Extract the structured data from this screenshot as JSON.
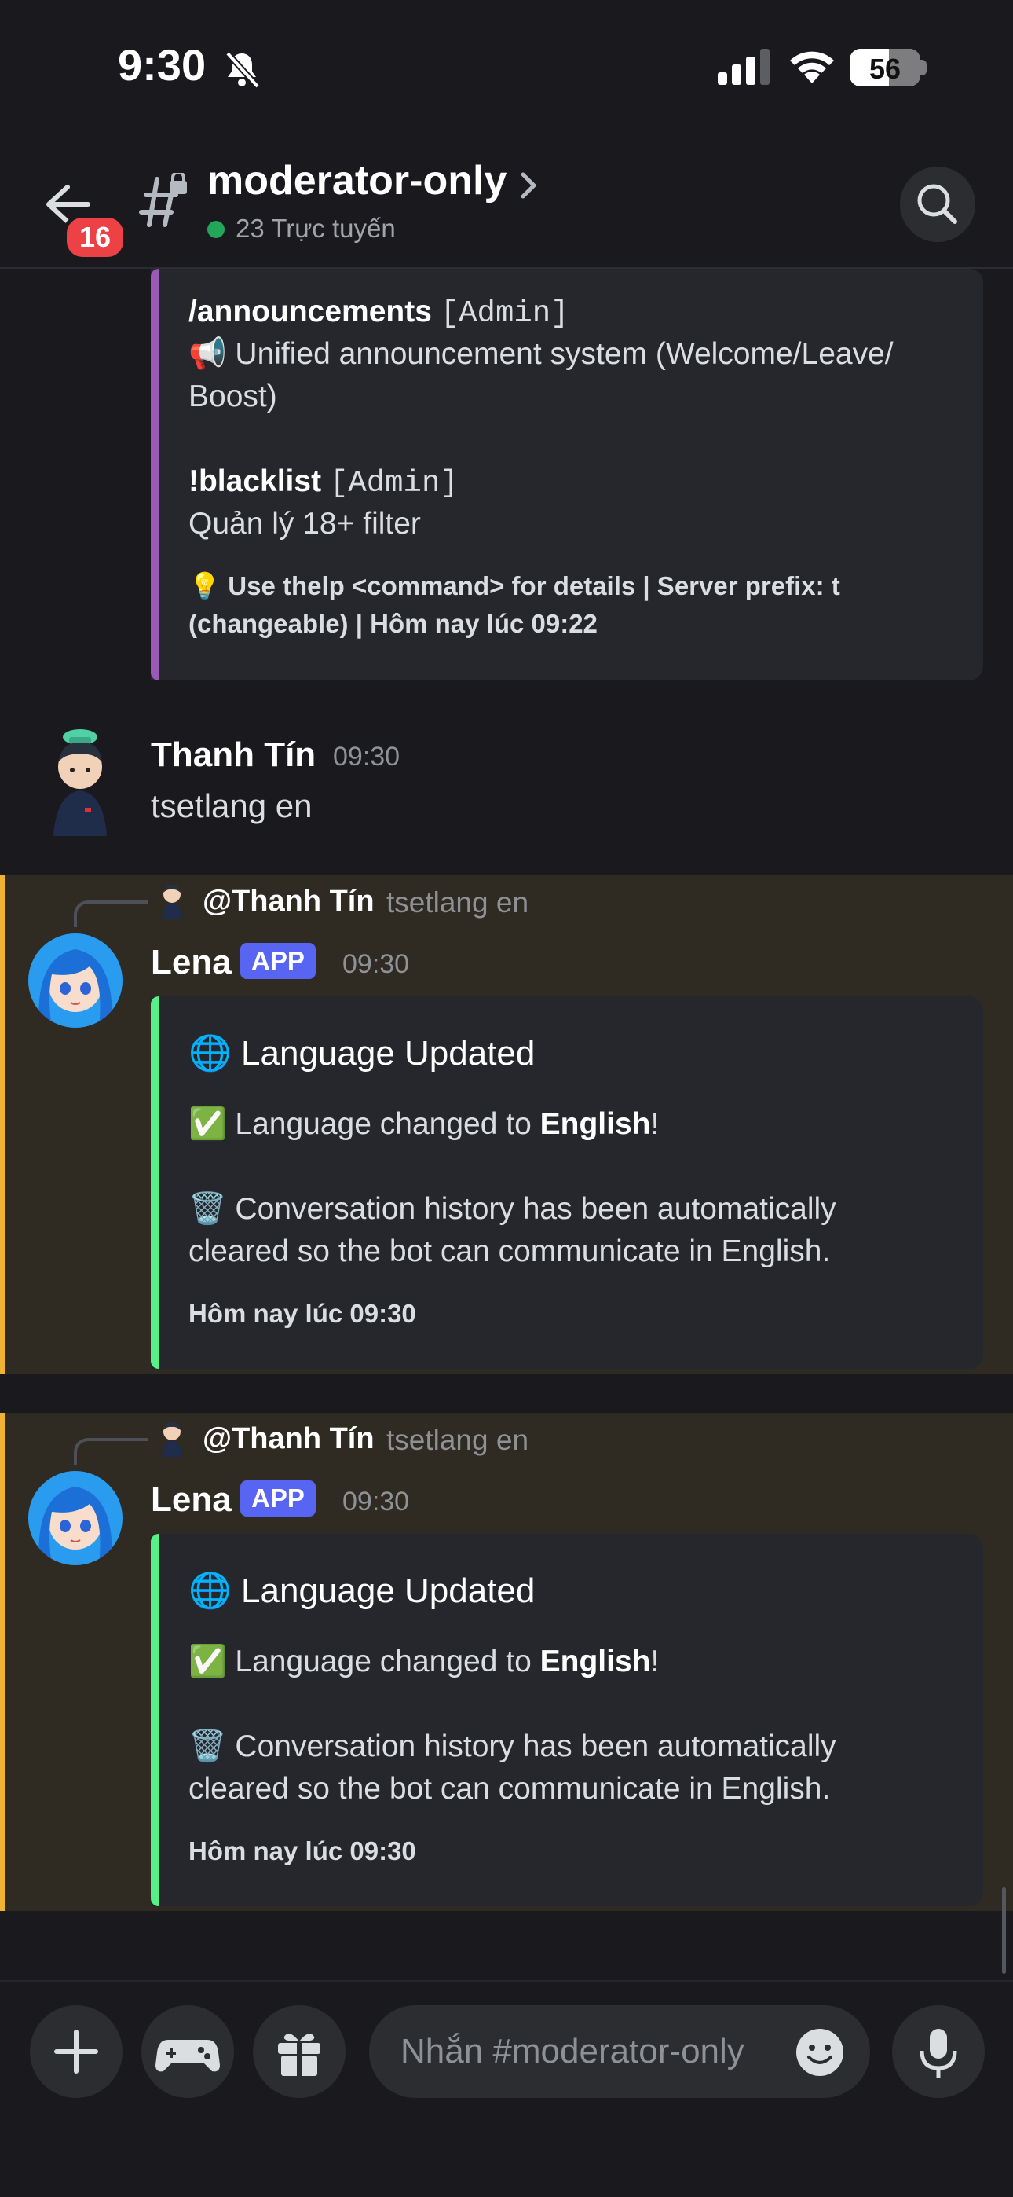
{
  "status_bar": {
    "time": "9:30",
    "battery": "56",
    "battery_level": 0.56
  },
  "header": {
    "back_badge": "16",
    "channel_name": "moderator-only",
    "online_text": "23 Trực tuyến"
  },
  "prev_embed": {
    "cmd1_name": "/announcements",
    "cmd1_tag": "[Admin]",
    "cmd1_icon": "📢",
    "cmd1_desc": "Unified announcement system (Welcome/Leave/",
    "cmd1_desc2": "Boost)",
    "cmd2_name": "!blacklist",
    "cmd2_tag": "[Admin]",
    "cmd2_desc": "Quản lý 18+ filter",
    "footer_icon": "💡",
    "footer_line1": "Use thelp <command> for details | Server prefix: t",
    "footer_line2": "(changeable) | Hôm nay lúc 09:22",
    "accent": "#9b59b6"
  },
  "user_message": {
    "author": "Thanh Tín",
    "time": "09:30",
    "text": "tsetlang en"
  },
  "bot_messages": [
    {
      "reply_to": "@Thanh Tín",
      "reply_text": "tsetlang en",
      "author": "Lena",
      "tag": "APP",
      "time": "09:30",
      "embed_icon": "🌐",
      "embed_title": "Language Updated",
      "line1_icon": "✅",
      "line1_prefix": "Language changed to ",
      "line1_bold": "English",
      "line1_suffix": "!",
      "line2_icon": "🗑️",
      "line2_a": "Conversation history has been automatically",
      "line2_b": "cleared so the bot can communicate in English.",
      "footer": "Hôm nay lúc 09:30",
      "accent": "#57f287"
    },
    {
      "reply_to": "@Thanh Tín",
      "reply_text": "tsetlang en",
      "author": "Lena",
      "tag": "APP",
      "time": "09:30",
      "embed_icon": "🌐",
      "embed_title": "Language Updated",
      "line1_icon": "✅",
      "line1_prefix": "Language changed to ",
      "line1_bold": "English",
      "line1_suffix": "!",
      "line2_icon": "🗑️",
      "line2_a": "Conversation history has been automatically",
      "line2_b": "cleared so the bot can communicate in English.",
      "footer": "Hôm nay lúc 09:30",
      "accent": "#57f287"
    }
  ],
  "composer": {
    "placeholder": "Nhắn #moderator-only"
  },
  "colors": {
    "background": "#1a1a1e",
    "mention_highlight": "#f0b232",
    "online": "#23a55a",
    "badge": "#ec4245",
    "app_tag": "#5865f2"
  }
}
